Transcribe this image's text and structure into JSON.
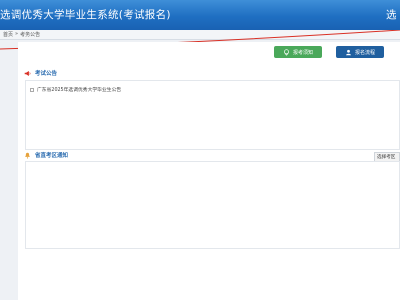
{
  "header": {
    "title": "选调优秀大学毕业生系统(考试报名)",
    "right_fragment": "选"
  },
  "breadcrumb": {
    "home": "首页",
    "separator": "»",
    "current": "考务公告"
  },
  "actions": {
    "exam_notice_label": "报考须知",
    "registration_label": "报名流程"
  },
  "exam_notice_section": {
    "title": "考试公告",
    "items": [
      "广东省2025年选调优秀大学毕业生公告"
    ]
  },
  "exam_area_section": {
    "title": "省直考区通知",
    "side_button_label": "选择考区"
  },
  "colors": {
    "header_blue": "#1f6fc2",
    "green_button": "#4aa85a",
    "blue_button": "#1f5f9f",
    "section_title": "#2b6cb0",
    "accent_red": "#d93025",
    "bell_orange": "#e6a23c"
  },
  "icons": {
    "exam_notice_icon": "location-pin-icon",
    "registration_icon": "user-group-icon",
    "announcement_icon": "megaphone-icon",
    "area_notice_icon": "bell-icon"
  }
}
